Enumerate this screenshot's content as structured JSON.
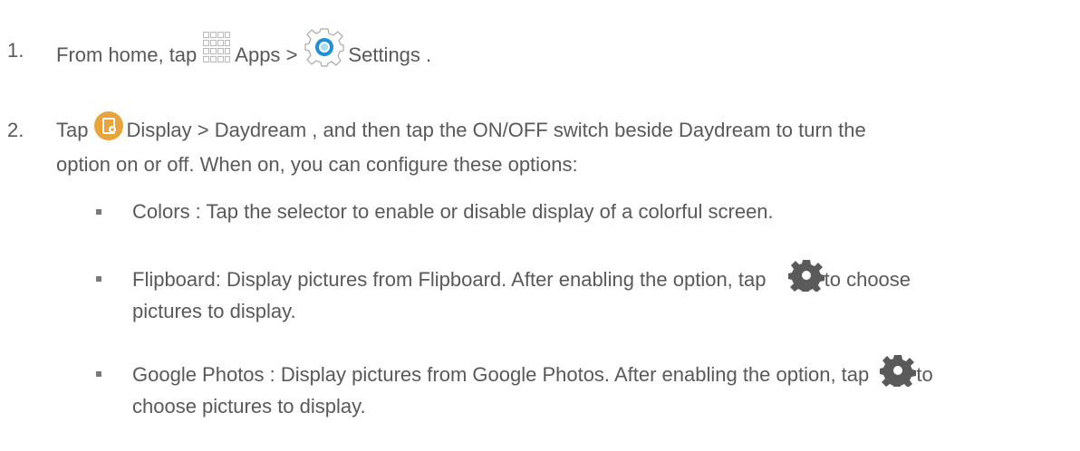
{
  "steps": [
    {
      "num": "1.",
      "t1": "From home, tap",
      "apps": "Apps",
      "sep": ">",
      "settings": "Settings",
      "end": "."
    },
    {
      "num": "2.",
      "t1": "Tap",
      "line1": "Display  > Daydream , and then tap the ON/OFF switch beside Daydream  to turn the",
      "line2": "option on or off. When on, you can configure these options:"
    }
  ],
  "options": [
    {
      "line1": "Colors : Tap the selector to enable or disable display of a colorful screen."
    },
    {
      "line1a": "Flipboard: Display pictures from Flipboard. After enabling the option, tap",
      "line1b": "to choose",
      "line2": "pictures to display."
    },
    {
      "line1a": "Google Photos  : Display pictures from Google Photos. After enabling the option, tap",
      "line1b": "to",
      "line2": "choose pictures to display."
    }
  ],
  "icons": {
    "apps": "apps-grid-icon",
    "settings": "settings-gear-icon",
    "display": "display-icon",
    "gear": "gear-icon"
  },
  "colors": {
    "text": "#595959",
    "display_icon": "#e8a33a",
    "settings_icon": "#1f8fd6",
    "gear": "#5a5a5a"
  }
}
